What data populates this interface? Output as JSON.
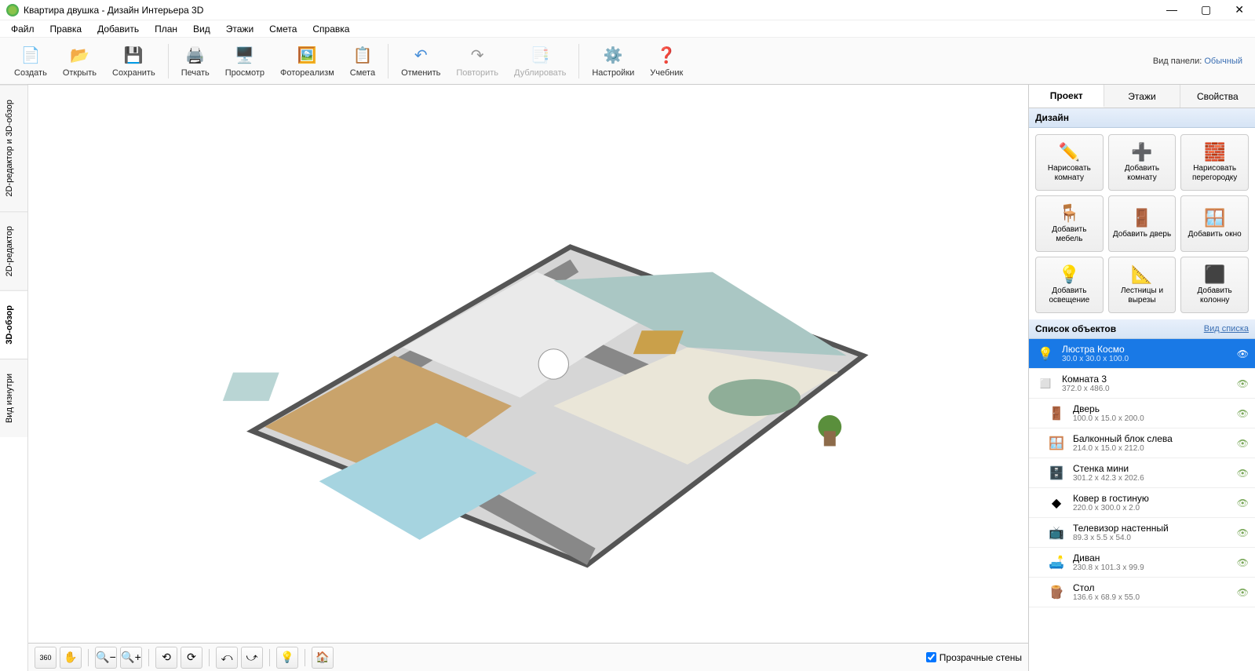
{
  "titlebar": {
    "title": "Квартира двушка - Дизайн Интерьера 3D"
  },
  "menu": [
    "Файл",
    "Правка",
    "Добавить",
    "План",
    "Вид",
    "Этажи",
    "Смета",
    "Справка"
  ],
  "toolbar": {
    "create": "Создать",
    "open": "Открыть",
    "save": "Сохранить",
    "print": "Печать",
    "preview": "Просмотр",
    "photorealism": "Фотореализм",
    "estimate": "Смета",
    "undo": "Отменить",
    "redo": "Повторить",
    "duplicate": "Дублировать",
    "settings": "Настройки",
    "tutorial": "Учебник",
    "panel_mode_label": "Вид панели:",
    "panel_mode_value": "Обычный"
  },
  "left_tabs": {
    "editor_both": "2D-редактор и 3D-обзор",
    "editor_2d": "2D-редактор",
    "view_3d": "3D-обзор",
    "view_inside": "Вид изнутри"
  },
  "view_toolbar": {
    "transparent_walls": "Прозрачные стены"
  },
  "right_tabs": {
    "project": "Проект",
    "floors": "Этажи",
    "properties": "Свойства"
  },
  "design": {
    "header": "Дизайн",
    "buttons": [
      {
        "label": "Нарисовать комнату",
        "icon": "✏️"
      },
      {
        "label": "Добавить комнату",
        "icon": "➕"
      },
      {
        "label": "Нарисовать перегородку",
        "icon": "🧱"
      },
      {
        "label": "Добавить мебель",
        "icon": "🪑"
      },
      {
        "label": "Добавить дверь",
        "icon": "🚪"
      },
      {
        "label": "Добавить окно",
        "icon": "🪟"
      },
      {
        "label": "Добавить освещение",
        "icon": "💡"
      },
      {
        "label": "Лестницы и вырезы",
        "icon": "📐"
      },
      {
        "label": "Добавить колонну",
        "icon": "⬛"
      }
    ]
  },
  "objects": {
    "header": "Список объектов",
    "view_link": "Вид списка",
    "items": [
      {
        "name": "Люстра Космо",
        "dims": "30.0 x 30.0 x 100.0",
        "icon": "💡",
        "selected": true,
        "indent": false
      },
      {
        "name": "Комната 3",
        "dims": "372.0 x 486.0",
        "icon": "◻️",
        "indent": false
      },
      {
        "name": "Дверь",
        "dims": "100.0 x 15.0 x 200.0",
        "icon": "🚪",
        "indent": true
      },
      {
        "name": "Балконный блок слева",
        "dims": "214.0 x 15.0 x 212.0",
        "icon": "🪟",
        "indent": true
      },
      {
        "name": "Стенка мини",
        "dims": "301.2 x 42.3 x 202.6",
        "icon": "🗄️",
        "indent": true
      },
      {
        "name": "Ковер в гостиную",
        "dims": "220.0 x 300.0 x 2.0",
        "icon": "◆",
        "indent": true
      },
      {
        "name": "Телевизор настенный",
        "dims": "89.3 x 5.5 x 54.0",
        "icon": "📺",
        "indent": true
      },
      {
        "name": "Диван",
        "dims": "230.8 x 101.3 x 99.9",
        "icon": "🛋️",
        "indent": true
      },
      {
        "name": "Стол",
        "dims": "136.6 x 68.9 x 55.0",
        "icon": "🪵",
        "indent": true
      }
    ]
  }
}
